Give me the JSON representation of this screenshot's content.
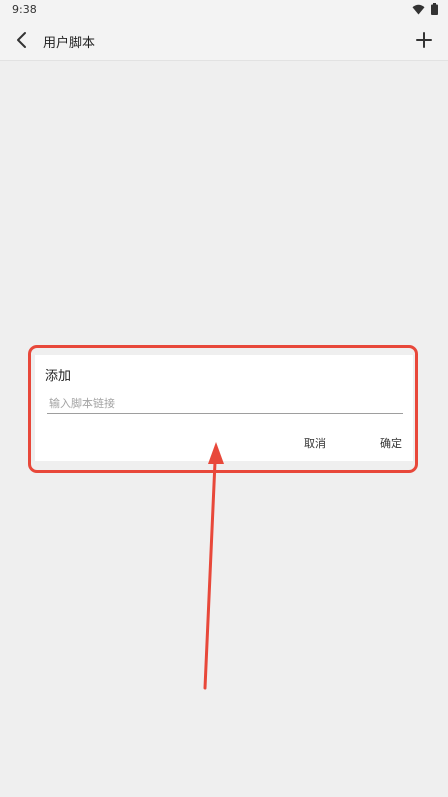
{
  "status_bar": {
    "time": "9:38",
    "icons": [
      "wifi-icon",
      "battery-icon"
    ]
  },
  "app_bar": {
    "title": "用户脚本",
    "back_icon": "chevron-left-icon",
    "add_icon": "plus-icon"
  },
  "dialog": {
    "title": "添加",
    "input": {
      "value": "",
      "placeholder": "输入脚本链接"
    },
    "cancel_label": "取消",
    "confirm_label": "确定"
  },
  "colors": {
    "background": "#efefef",
    "app_bar": "#f3f3f3",
    "dialog": "#ffffff",
    "annotation": "#e8483a"
  }
}
